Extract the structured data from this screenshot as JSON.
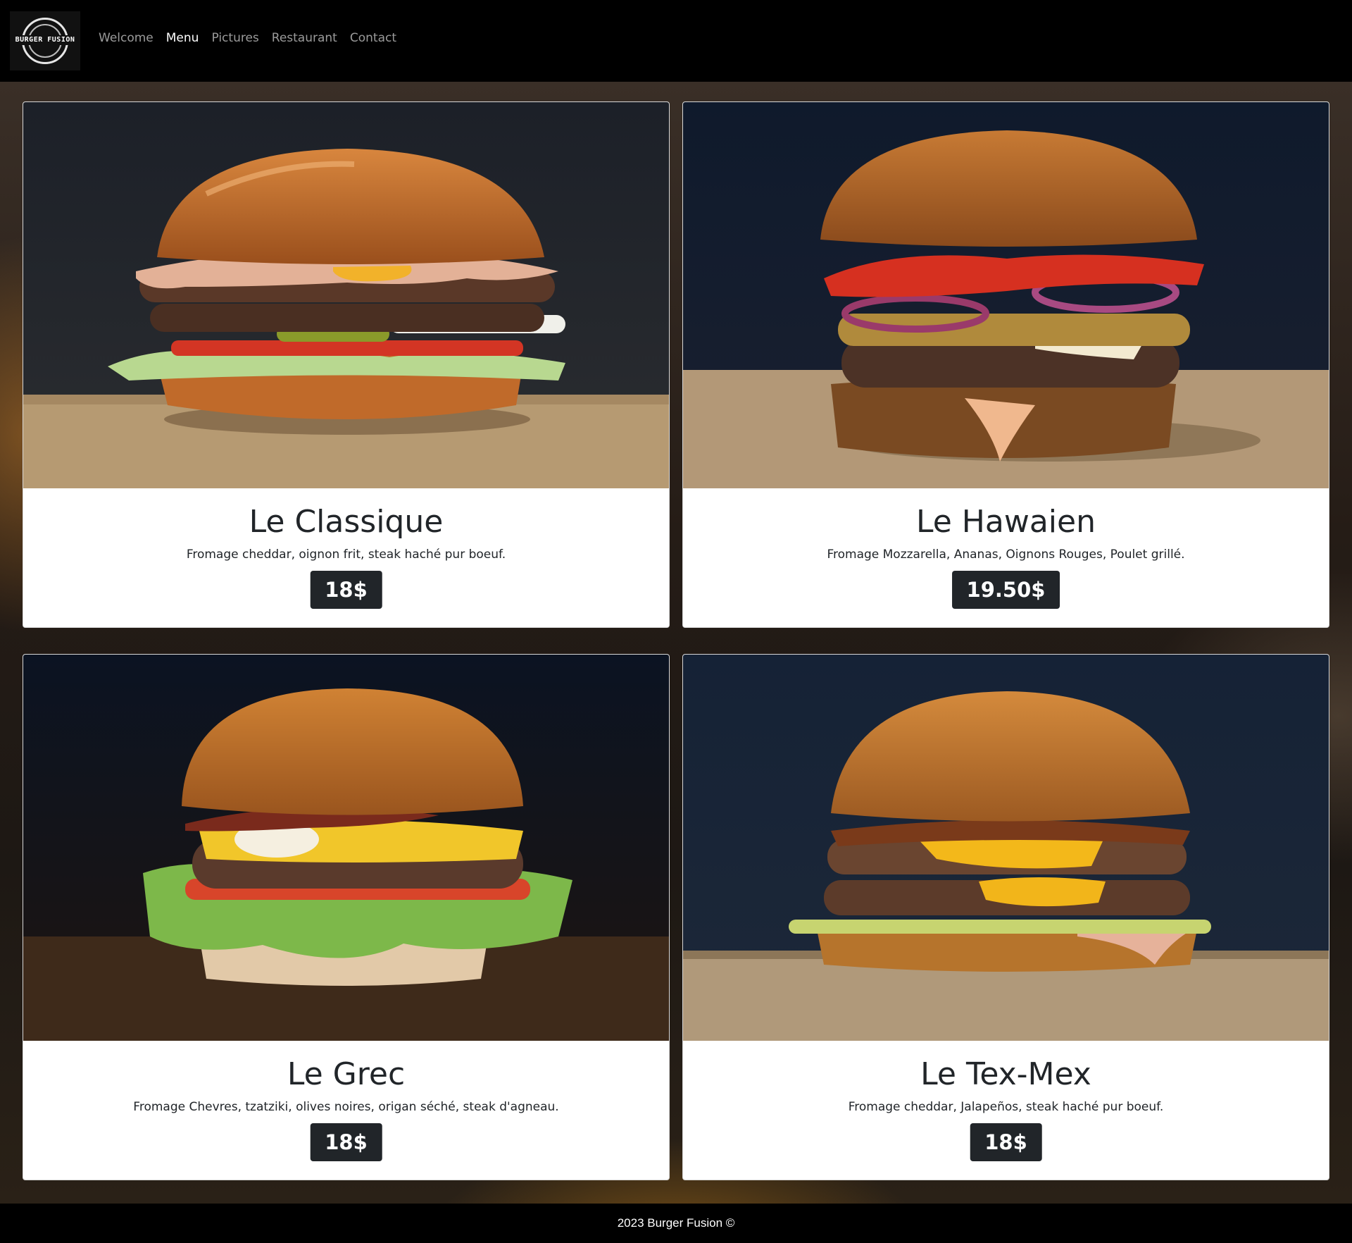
{
  "brand": {
    "logo_text": "BURGER FUSION"
  },
  "nav": {
    "items": [
      {
        "label": "Welcome",
        "active": false
      },
      {
        "label": "Menu",
        "active": true
      },
      {
        "label": "Pictures",
        "active": false
      },
      {
        "label": "Restaurant",
        "active": false
      },
      {
        "label": "Contact",
        "active": false
      }
    ]
  },
  "menu": {
    "items": [
      {
        "title": "Le Classique",
        "description": "Fromage cheddar, oignon frit, steak haché pur boeuf.",
        "price": "18$"
      },
      {
        "title": "Le Hawaien",
        "description": "Fromage Mozzarella, Ananas, Oignons Rouges, Poulet grillé.",
        "price": "19.50$"
      },
      {
        "title": "Le Grec",
        "description": "Fromage Chevres, tzatziki, olives noires, origan séché, steak d'agneau.",
        "price": "18$"
      },
      {
        "title": "Le Tex-Mex",
        "description": "Fromage cheddar, Jalapeños, steak haché pur boeuf.",
        "price": "18$"
      }
    ]
  },
  "footer": {
    "text": "2023 Burger Fusion ©"
  },
  "colors": {
    "navbar": "#000000",
    "card": "#ffffff",
    "price_badge": "#212529",
    "text": "#212529"
  },
  "icons": {
    "logo": "burger-fusion-logo-icon"
  }
}
